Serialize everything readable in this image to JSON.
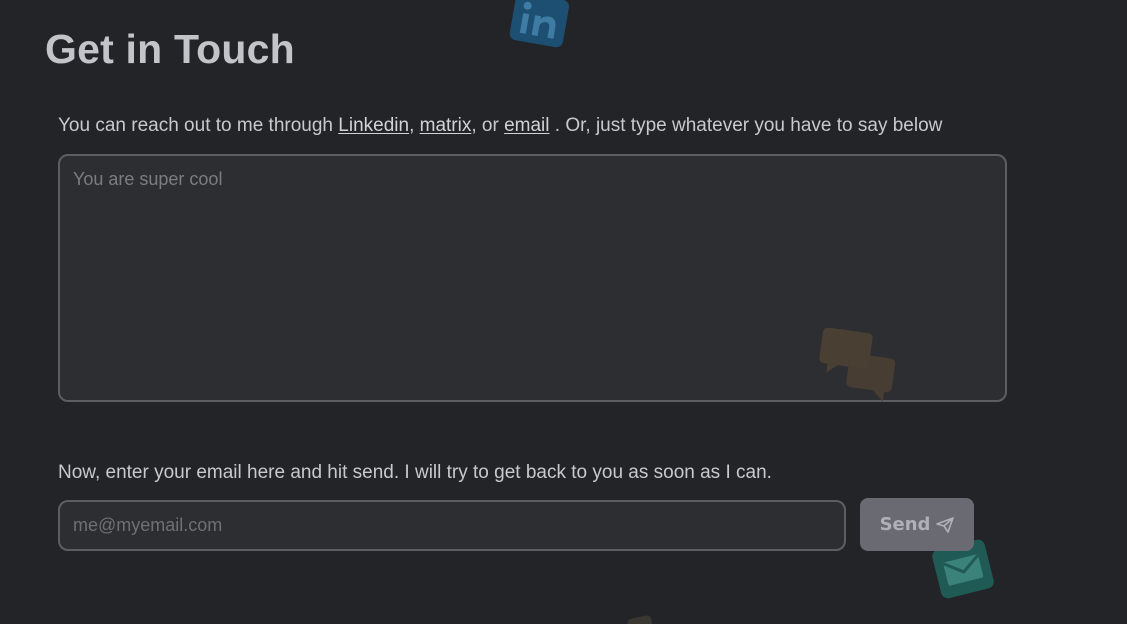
{
  "page": {
    "title": "Get in Touch"
  },
  "intro": {
    "prefix": "You can reach out to me through ",
    "linkedin_label": "Linkedin",
    "sep1": ", ",
    "matrix_label": "matrix",
    "sep2": ", or ",
    "email_label": "email",
    "suffix": " . Or, just type whatever you have to say below"
  },
  "message": {
    "placeholder": "You are super cool",
    "value": ""
  },
  "email_form": {
    "prompt": "Now, enter your email here and hit send. I will try to get back to you as soon as I can.",
    "placeholder": "me@myemail.com",
    "value": "",
    "send_label": "Send"
  },
  "icons": {
    "linkedin": "linkedin-icon",
    "chat": "chat-bubbles-icon",
    "envelope": "envelope-icon",
    "send": "paper-plane-icon"
  },
  "colors": {
    "background": "#232427",
    "linkedin_blue": "#1d4f73",
    "chat_brown": "#4a3f33",
    "envelope_teal": "#1f5a55",
    "button": "#6a6b72"
  }
}
